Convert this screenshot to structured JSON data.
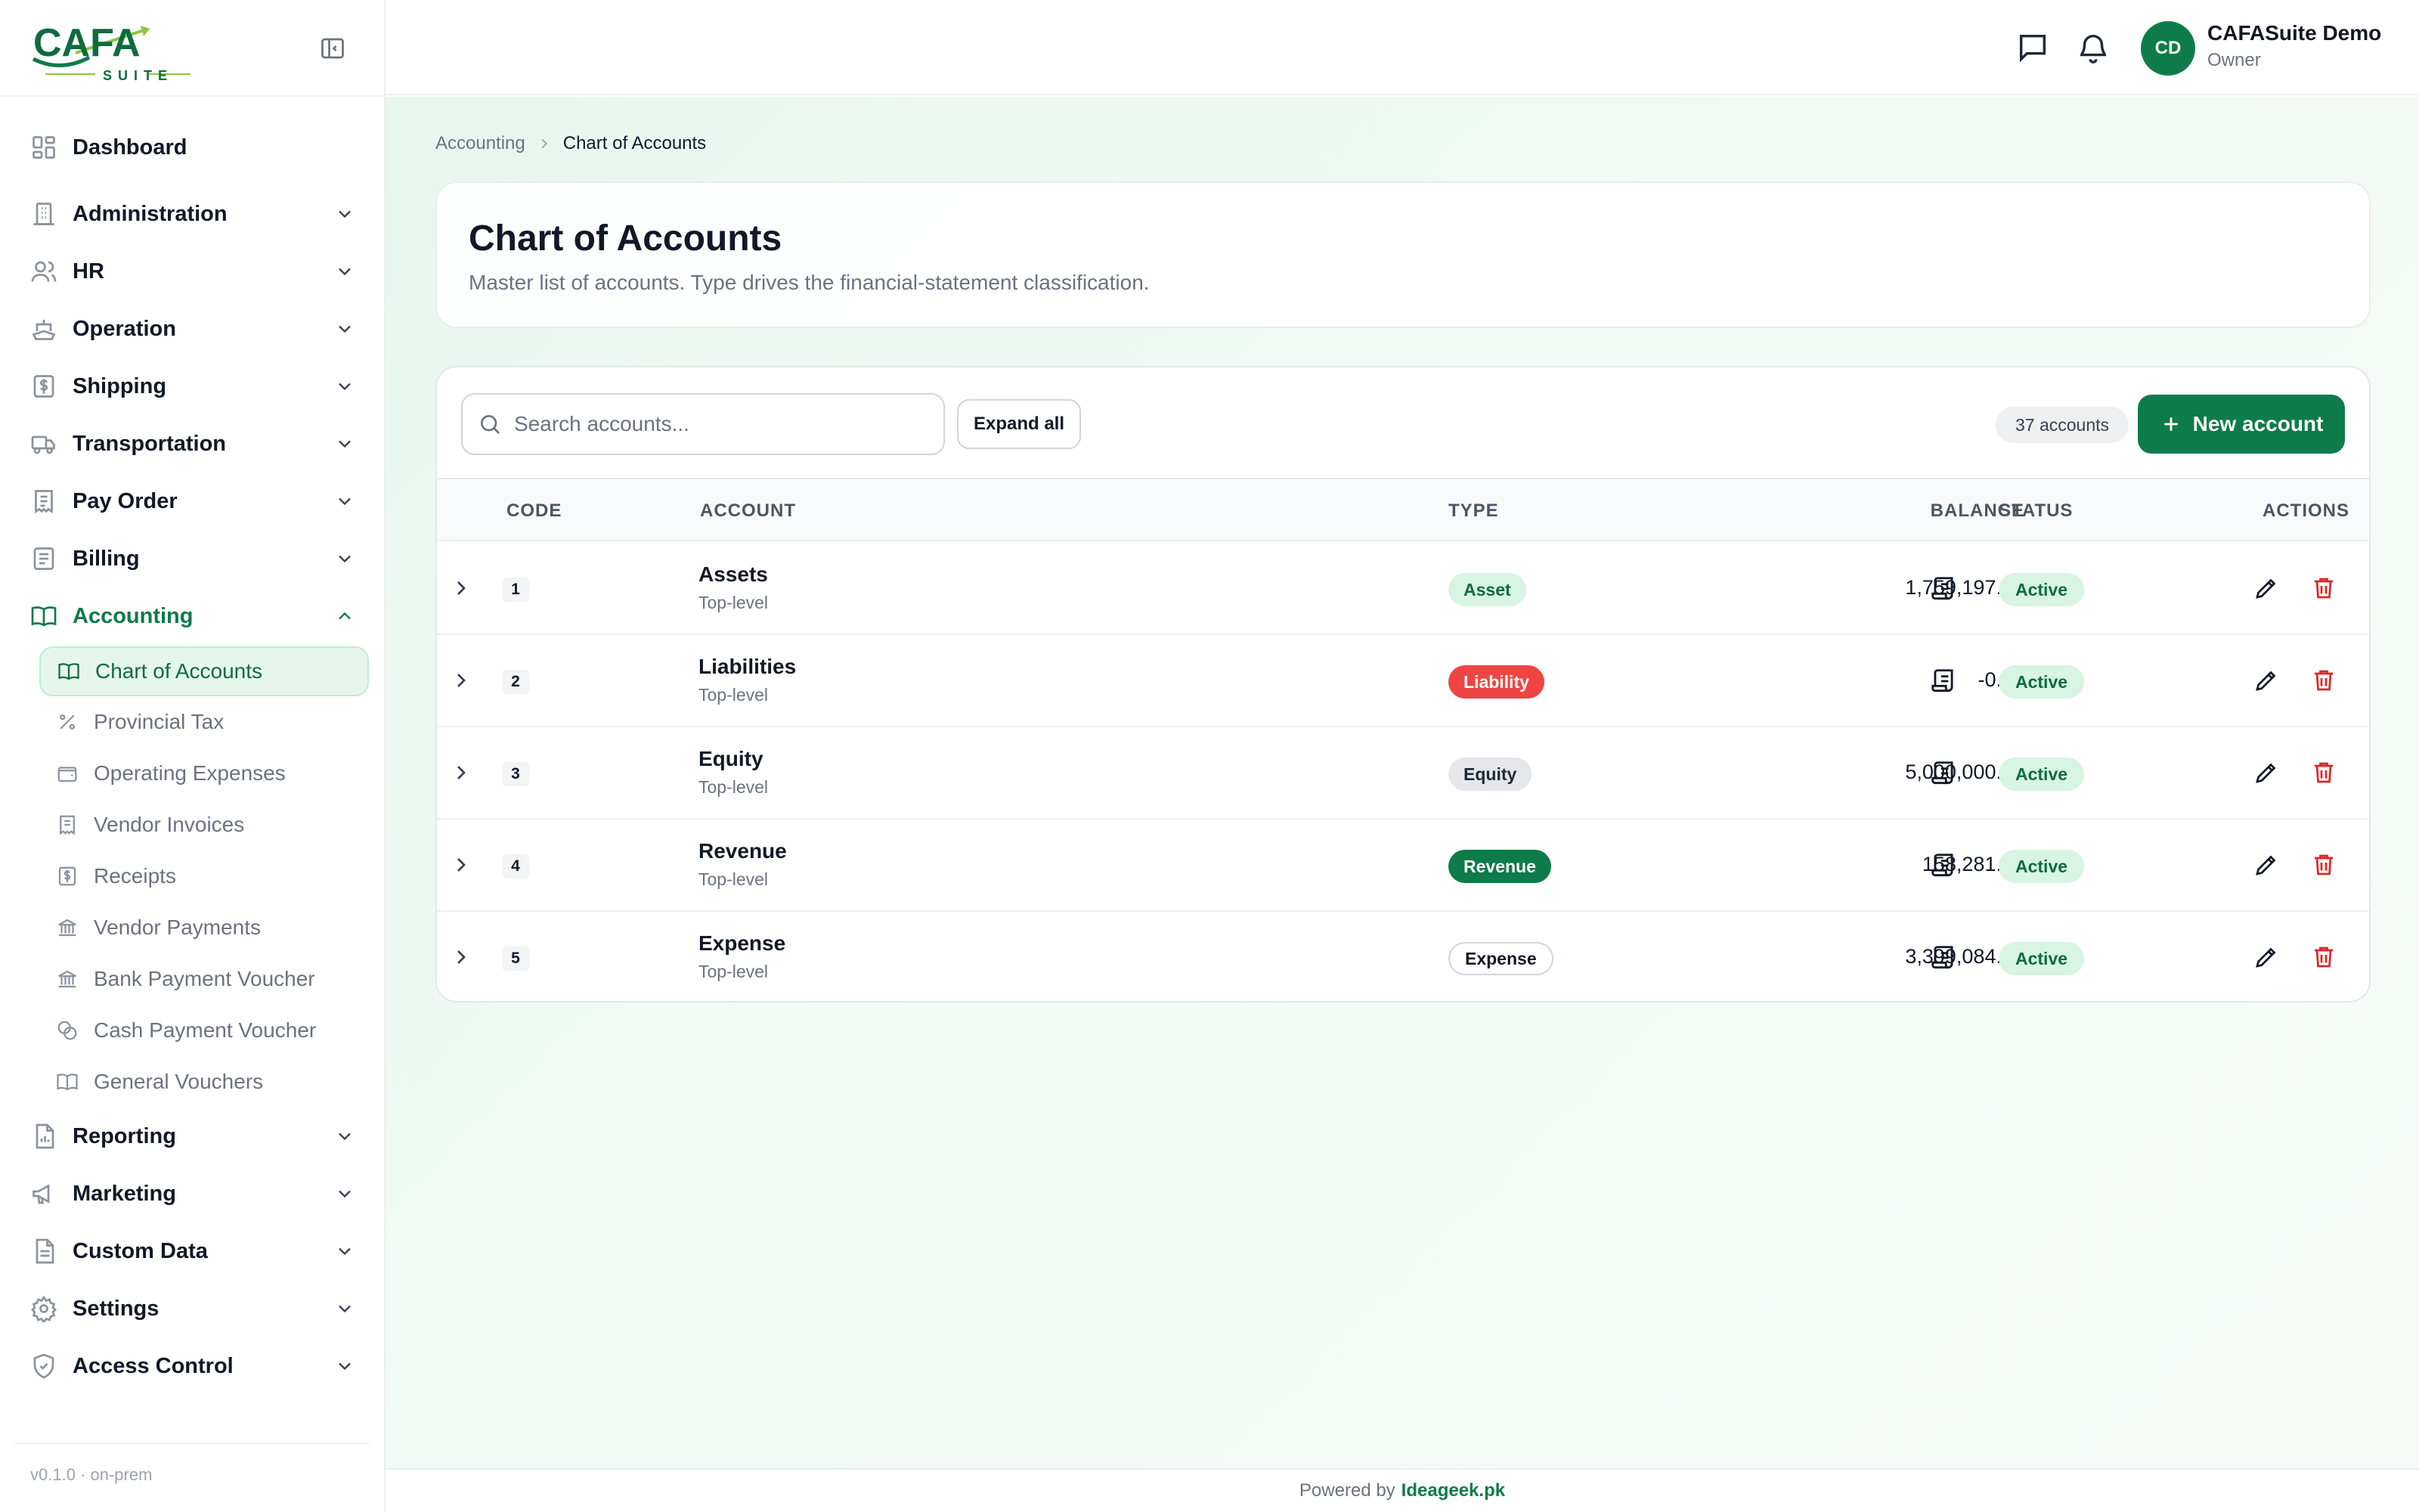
{
  "brand": {
    "logo_text": "CAFA",
    "logo_sub": "SUITE"
  },
  "sidebar": {
    "items": [
      {
        "label": "Dashboard",
        "icon": "dashboard-icon"
      },
      {
        "label": "Administration",
        "icon": "building-icon"
      },
      {
        "label": "HR",
        "icon": "users-icon"
      },
      {
        "label": "Operation",
        "icon": "ship-icon"
      },
      {
        "label": "Shipping",
        "icon": "dollar-doc-icon"
      },
      {
        "label": "Transportation",
        "icon": "truck-icon"
      },
      {
        "label": "Pay Order",
        "icon": "receipt-icon"
      },
      {
        "label": "Billing",
        "icon": "billing-icon"
      },
      {
        "label": "Accounting",
        "icon": "book-icon"
      },
      {
        "label": "Reporting",
        "icon": "report-icon"
      },
      {
        "label": "Marketing",
        "icon": "megaphone-icon"
      },
      {
        "label": "Custom Data",
        "icon": "document-icon"
      },
      {
        "label": "Settings",
        "icon": "gear-icon"
      },
      {
        "label": "Access Control",
        "icon": "shield-icon"
      }
    ],
    "accounting_sub": [
      {
        "label": "Chart of Accounts",
        "icon": "book-icon"
      },
      {
        "label": "Provincial Tax",
        "icon": "percent-icon"
      },
      {
        "label": "Operating Expenses",
        "icon": "wallet-icon"
      },
      {
        "label": "Vendor Invoices",
        "icon": "receipt-icon"
      },
      {
        "label": "Receipts",
        "icon": "dollar-doc-icon"
      },
      {
        "label": "Vendor Payments",
        "icon": "bank-icon"
      },
      {
        "label": "Bank Payment Voucher",
        "icon": "bank-icon"
      },
      {
        "label": "Cash Payment Voucher",
        "icon": "coins-icon"
      },
      {
        "label": "General Vouchers",
        "icon": "book-icon"
      }
    ],
    "version": "v0.1.0 · on-prem"
  },
  "header": {
    "user_initials": "CD",
    "user_name": "CAFASuite Demo",
    "user_role": "Owner"
  },
  "breadcrumb": {
    "parent": "Accounting",
    "current": "Chart of Accounts"
  },
  "page": {
    "title": "Chart of Accounts",
    "subtitle": "Master list of accounts. Type drives the financial-statement classification."
  },
  "toolbar": {
    "search_placeholder": "Search accounts...",
    "expand_label": "Expand all",
    "count_label": "37 accounts",
    "new_label": "New account"
  },
  "table": {
    "headers": {
      "code": "CODE",
      "account": "ACCOUNT",
      "type": "TYPE",
      "balance": "BALANCE",
      "status": "STATUS",
      "actions": "ACTIONS"
    },
    "rows": [
      {
        "code": "1",
        "name": "Assets",
        "level": "Top-level",
        "type": "Asset",
        "balance": "1,759,197.00",
        "status": "Active"
      },
      {
        "code": "2",
        "name": "Liabilities",
        "level": "Top-level",
        "type": "Liability",
        "balance": "-0.00",
        "status": "Active"
      },
      {
        "code": "3",
        "name": "Equity",
        "level": "Top-level",
        "type": "Equity",
        "balance": "5,000,000.00",
        "status": "Active"
      },
      {
        "code": "4",
        "name": "Revenue",
        "level": "Top-level",
        "type": "Revenue",
        "balance": "158,281.00",
        "status": "Active"
      },
      {
        "code": "5",
        "name": "Expense",
        "level": "Top-level",
        "type": "Expense",
        "balance": "3,399,084.00",
        "status": "Active"
      }
    ]
  },
  "type_colors": {
    "Asset": {
      "bg": "#d8f4e3",
      "fg": "#0e6b40"
    },
    "Liability": {
      "bg": "#ef4444",
      "fg": "#ffffff"
    },
    "Equity": {
      "bg": "#e5e7eb",
      "fg": "#1f2937"
    },
    "Revenue": {
      "bg": "#0e7b4a",
      "fg": "#ffffff"
    },
    "Expense": {
      "bg": "#ffffff",
      "fg": "#111827",
      "border": "#d1d5db"
    }
  },
  "footer": {
    "prefix": "Powered by",
    "link": "Ideageek.pk"
  },
  "colors": {
    "accent": "#0e7b4a",
    "danger": "#dc2626"
  }
}
